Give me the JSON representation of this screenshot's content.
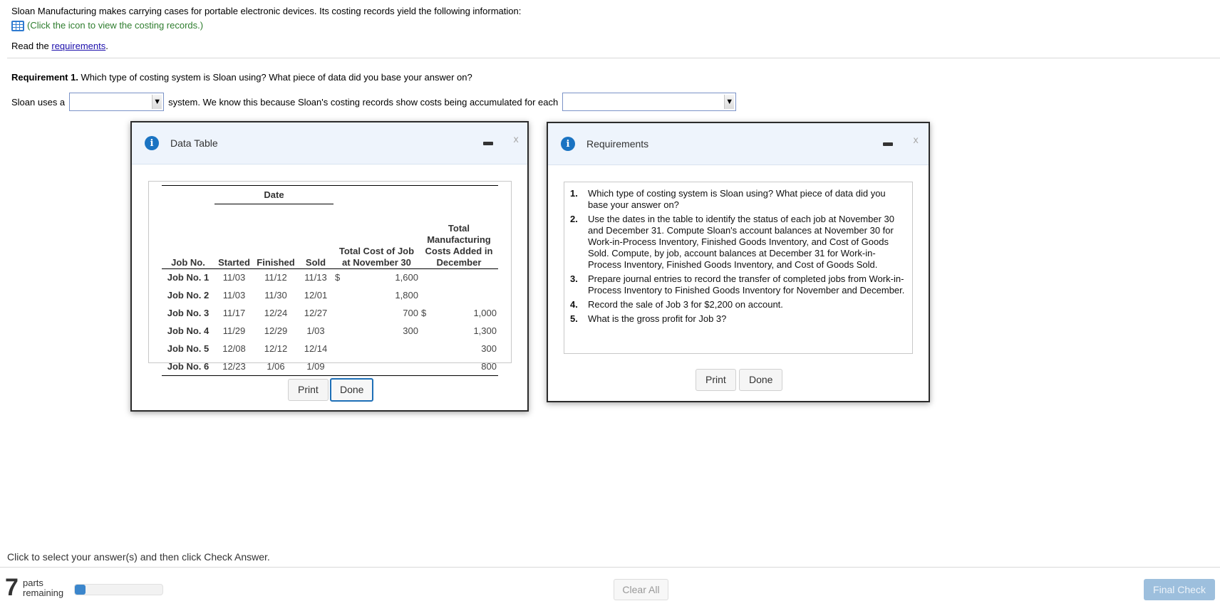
{
  "intro": {
    "text": "Sloan Manufacturing makes carrying cases for portable electronic devices. Its costing records yield the following information:",
    "costing_link": "(Click the icon to view the costing records.)",
    "read_prefix": "Read the ",
    "requirements_link": "requirements",
    "read_suffix": "."
  },
  "question": {
    "req_label": "Requirement 1.",
    "req_text": " Which type of costing system is Sloan using? What piece of data did you base your answer on?",
    "answer_prefix": "Sloan uses a",
    "answer_middle": "system. We know this because Sloan's costing records show costs being accumulated for each",
    "select1_value": "",
    "select2_value": "",
    "dropdown_arrow": "▼"
  },
  "data_table_dialog": {
    "title": "Data Table",
    "close_glyph": "x",
    "table": {
      "group_header": "Date",
      "headers": [
        "Job No.",
        "Started",
        "Finished",
        "Sold",
        "Total Cost of Job at November 30",
        "Total Manufacturing Costs Added in December"
      ],
      "rows": [
        {
          "job": "Job No. 1",
          "started": "11/03",
          "finished": "11/12",
          "sold": "11/13",
          "nov_sign": "$",
          "nov": "1,600",
          "dec_sign": "",
          "dec": ""
        },
        {
          "job": "Job No. 2",
          "started": "11/03",
          "finished": "11/30",
          "sold": "12/01",
          "nov_sign": "",
          "nov": "1,800",
          "dec_sign": "",
          "dec": ""
        },
        {
          "job": "Job No. 3",
          "started": "11/17",
          "finished": "12/24",
          "sold": "12/27",
          "nov_sign": "",
          "nov": "700",
          "dec_sign": "$",
          "dec": "1,000"
        },
        {
          "job": "Job No. 4",
          "started": "11/29",
          "finished": "12/29",
          "sold": "1/03",
          "nov_sign": "",
          "nov": "300",
          "dec_sign": "",
          "dec": "1,300"
        },
        {
          "job": "Job No. 5",
          "started": "12/08",
          "finished": "12/12",
          "sold": "12/14",
          "nov_sign": "",
          "nov": "",
          "dec_sign": "",
          "dec": "300"
        },
        {
          "job": "Job No. 6",
          "started": "12/23",
          "finished": "1/06",
          "sold": "1/09",
          "nov_sign": "",
          "nov": "",
          "dec_sign": "",
          "dec": "800"
        }
      ]
    },
    "print_label": "Print",
    "done_label": "Done"
  },
  "requirements_dialog": {
    "title": "Requirements",
    "close_glyph": "x",
    "items": [
      {
        "num": "1.",
        "text": "Which type of costing system is Sloan using? What piece of data did you base your answer on?"
      },
      {
        "num": "2.",
        "text": "Use the dates in the table to identify the status of each job at November 30 and December 31. Compute Sloan's account balances at November 30 for Work-in-Process Inventory, Finished Goods Inventory, and Cost of Goods Sold. Compute, by job, account balances at December 31 for Work-in-Process Inventory, Finished Goods Inventory, and Cost of Goods Sold."
      },
      {
        "num": "3.",
        "text": "Prepare journal entries to record the transfer of completed jobs from Work-in-Process Inventory to Finished Goods Inventory for November and December."
      },
      {
        "num": "4.",
        "text": "Record the sale of Job 3 for $2,200 on account."
      },
      {
        "num": "5.",
        "text": "What is the gross profit for Job 3?"
      }
    ],
    "print_label": "Print",
    "done_label": "Done"
  },
  "footer": {
    "instruction": "Click to select your answer(s) and then click Check Answer.",
    "parts_count": "7",
    "parts_label_1": "parts",
    "parts_label_2": "remaining",
    "progress_fraction": 0.12,
    "clear_all": "Clear All",
    "final_check": "Final Check"
  }
}
